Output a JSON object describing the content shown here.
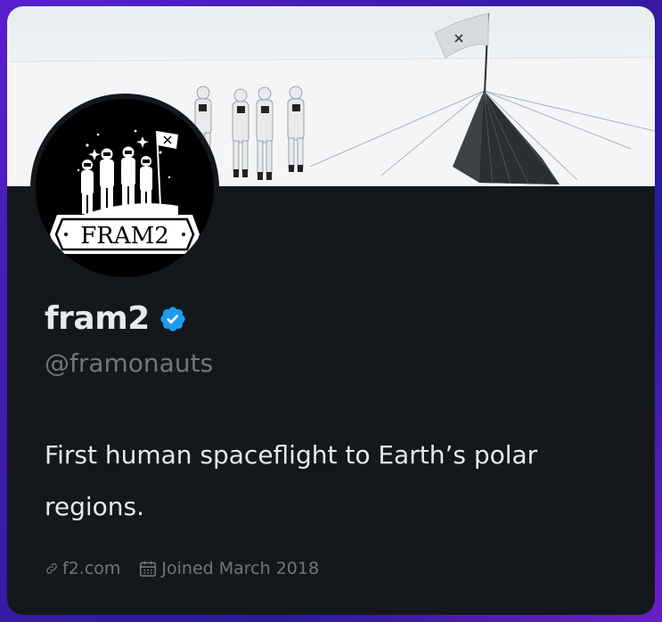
{
  "profile": {
    "display_name": "fram2",
    "handle": "@framonauts",
    "bio": "First human spaceflight to Earth’s polar regions.",
    "website": "f2.com",
    "joined": "Joined March 2018",
    "verified": true,
    "avatar_logo_text": "FRAM2"
  },
  "icons": {
    "verified": "verified-badge-icon",
    "link": "link-icon",
    "calendar": "calendar-icon"
  },
  "colors": {
    "background": "#14181c",
    "primary_text": "#e7e9ea",
    "secondary_text": "#71767b",
    "verified_blue": "#1d9bf0"
  }
}
